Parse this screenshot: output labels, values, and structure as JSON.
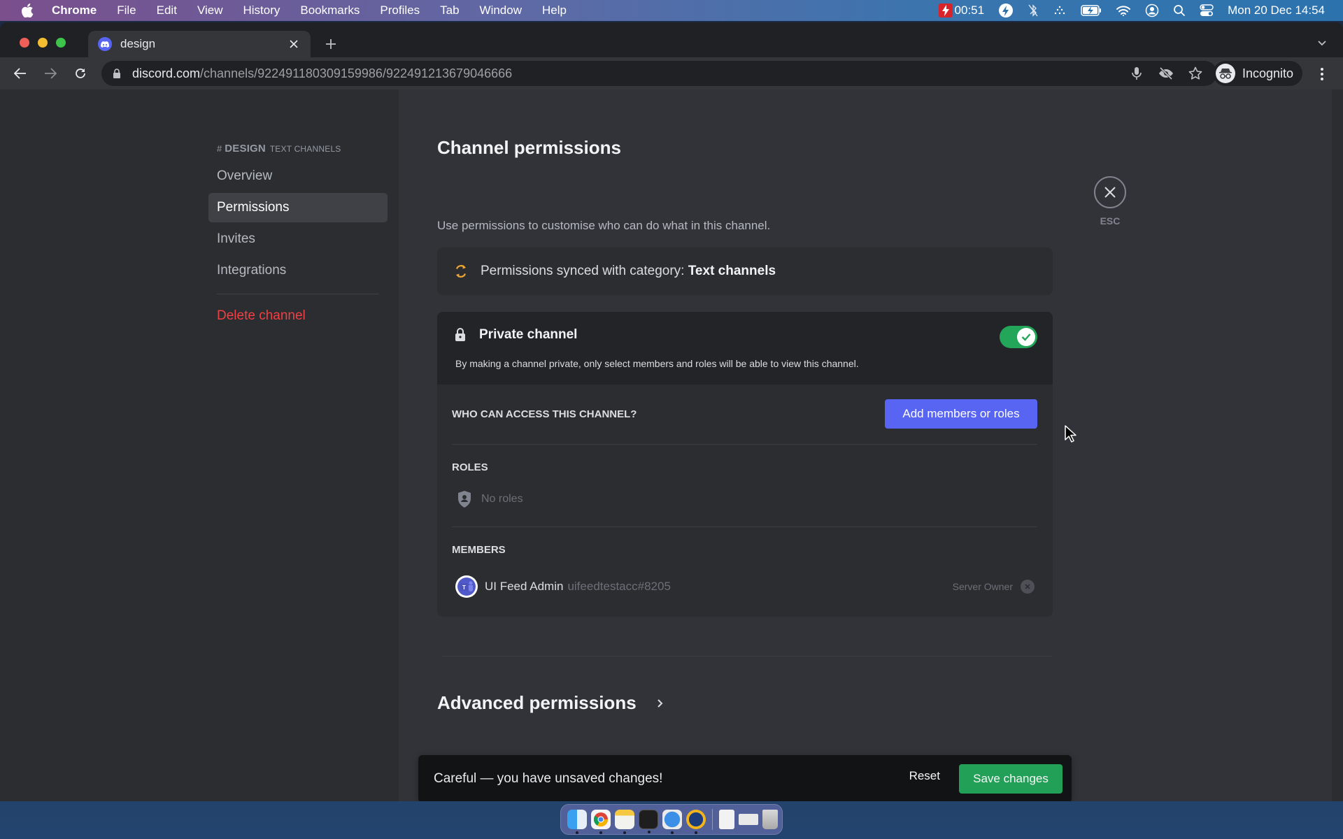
{
  "menubar": {
    "app_name": "Chrome",
    "items": [
      "File",
      "Edit",
      "View",
      "History",
      "Bookmarks",
      "Profiles",
      "Tab",
      "Window",
      "Help"
    ],
    "recording_timer": "00:51",
    "clock": "Mon 20 Dec  14:54",
    "status_icons": [
      "bolt-app-icon",
      "bluetooth-off-icon",
      "dots-icon",
      "battery-charging-icon",
      "wifi-icon",
      "user-circle-icon",
      "spotlight-search-icon",
      "control-center-icon"
    ]
  },
  "browser": {
    "tab_title": "design",
    "url_host": "discord.com",
    "url_path": "/channels/922491180309159986/922491213679046666",
    "profile_label": "Incognito"
  },
  "sidebar": {
    "channel_name": "DESIGN",
    "category": "TEXT CHANNELS",
    "items": [
      {
        "label": "Overview",
        "active": false
      },
      {
        "label": "Permissions",
        "active": true
      },
      {
        "label": "Invites",
        "active": false
      },
      {
        "label": "Integrations",
        "active": false
      }
    ],
    "delete_label": "Delete channel"
  },
  "main": {
    "title": "Channel permissions",
    "subtitle": "Use permissions to customise who can do what in this channel.",
    "sync_prefix": "Permissions synced with category: ",
    "sync_category": "Text channels",
    "private": {
      "title": "Private channel",
      "description": "By making a channel private, only select members and roles will be able to view this channel.",
      "enabled": true
    },
    "access_label": "WHO CAN ACCESS THIS CHANNEL?",
    "add_button": "Add members or roles",
    "roles_label": "ROLES",
    "no_roles": "No roles",
    "members_label": "MEMBERS",
    "members": [
      {
        "name": "UI Feed Admin",
        "tag": "uifeedtestacc#8205",
        "badge": "Server Owner"
      }
    ],
    "advanced_title": "Advanced permissions"
  },
  "close": {
    "label": "ESC"
  },
  "notice": {
    "message": "Careful — you have unsaved changes!",
    "reset_label": "Reset",
    "save_label": "Save changes"
  },
  "colors": {
    "blurple": "#5865f2",
    "green": "#23a55a",
    "danger": "#f23f43",
    "sync_orange": "#f0a632"
  },
  "dock": {
    "apps": [
      "finder",
      "chrome",
      "notes",
      "terminal",
      "safari",
      "bolt-app",
      "preview-file",
      "screenshot-file",
      "trash"
    ]
  }
}
